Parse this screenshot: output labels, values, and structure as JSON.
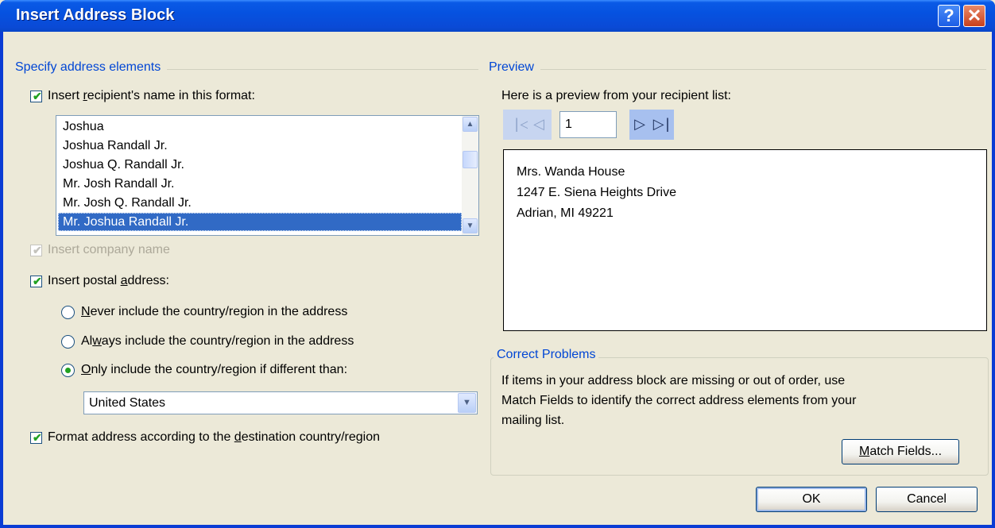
{
  "window": {
    "title": "Insert Address Block",
    "help_glyph": "?",
    "close_glyph": "✕"
  },
  "specify": {
    "heading": "Specify address elements",
    "name_format_label": {
      "before": "Insert ",
      "ul": "r",
      "after": "ecipient's name in this format:"
    },
    "name_formats": [
      "Joshua",
      "Joshua Randall Jr.",
      "Joshua Q. Randall Jr.",
      "Mr. Josh Randall Jr.",
      "Mr. Josh Q. Randall Jr.",
      "Mr. Joshua Randall Jr."
    ],
    "selected_index": 5,
    "company_label": "Insert company name",
    "postal_label": {
      "before": "Insert postal ",
      "ul": "a",
      "after": "ddress:"
    },
    "radio_never": {
      "ul": "N",
      "after": "ever include the country/region in the address"
    },
    "radio_always": {
      "before": "Al",
      "ul": "w",
      "after": "ays include the country/region in the address"
    },
    "radio_only": {
      "ul": "O",
      "after": "nly include the country/region if different than:"
    },
    "country_value": "United States",
    "format_label": {
      "before": "Format address according to the ",
      "ul": "d",
      "after": "estination country/region"
    }
  },
  "preview": {
    "heading": "Preview",
    "intro": "Here is a preview from your recipient list:",
    "record_number": "1",
    "first_glyph": "|◁",
    "prev_glyph": "◁",
    "next_glyph": "▷",
    "last_glyph": "▷|",
    "address_lines": [
      "Mrs. Wanda House",
      "1247 E. Siena Heights Drive",
      "Adrian, MI 49221"
    ]
  },
  "correct": {
    "heading": "Correct Problems",
    "text_lines": [
      "If items in your address block are missing or out of order, use",
      "Match Fields to identify the correct address elements from your",
      "mailing list."
    ],
    "match_button": {
      "ul": "M",
      "after": "atch Fields..."
    }
  },
  "buttons": {
    "ok": "OK",
    "cancel": "Cancel"
  },
  "icons": {
    "checkmark": "✔",
    "scroll_up": "▲",
    "scroll_down": "▼",
    "dropdown": "▼"
  }
}
